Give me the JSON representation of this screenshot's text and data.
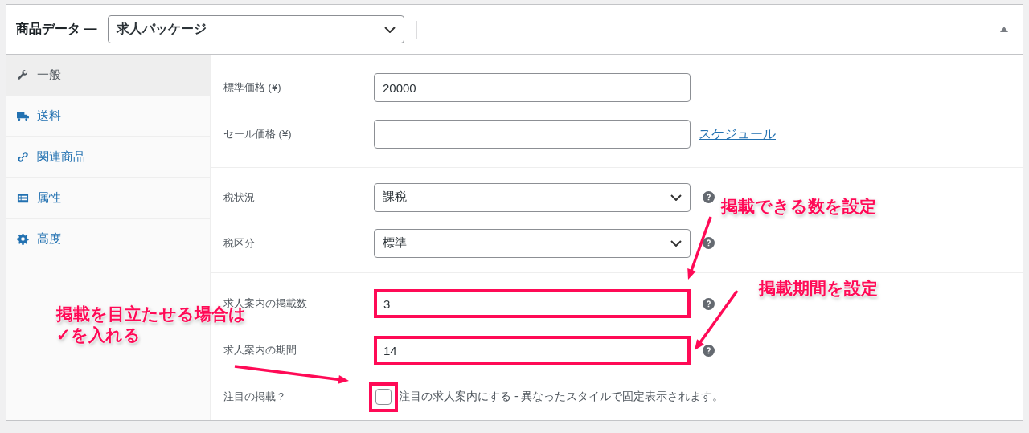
{
  "header": {
    "title": "商品データ —",
    "product_type": "求人パッケージ",
    "expanded": true
  },
  "tabs": [
    {
      "label": "一般",
      "selected": true
    },
    {
      "label": "送料",
      "selected": false
    },
    {
      "label": "関連商品",
      "selected": false
    },
    {
      "label": "属性",
      "selected": false
    },
    {
      "label": "高度",
      "selected": false
    }
  ],
  "sections": [
    {
      "fields": [
        {
          "kind": "input",
          "label": "標準価格 (¥)",
          "value": "20000",
          "highlighted": false
        },
        {
          "kind": "input",
          "label": "セール価格 (¥)",
          "link": "スケジュール",
          "highlighted": false
        }
      ]
    },
    {
      "fields": [
        {
          "kind": "select",
          "label": "税状況",
          "value": "課税",
          "help": true,
          "highlighted": false
        },
        {
          "kind": "select",
          "label": "税区分",
          "value": "標準",
          "help": true,
          "highlighted": false
        }
      ]
    },
    {
      "fields": [
        {
          "kind": "input",
          "label": "求人案内の掲載数",
          "value": "3",
          "help": true,
          "highlighted": true
        },
        {
          "kind": "input",
          "label": "求人案内の期間",
          "value": "14",
          "help": true,
          "highlighted": true
        },
        {
          "kind": "checkbox",
          "label": "注目の掲載？",
          "checked": false,
          "description": "注目の求人案内にする - 異なったスタイルで固定表示されます。",
          "highlighted": true
        }
      ]
    }
  ],
  "callouts": [
    {
      "lines": [
        "掲載できる数を設定"
      ]
    },
    {
      "lines": [
        "掲載期間を設定"
      ]
    },
    {
      "lines": [
        "掲載を目立たせる場合は",
        "✓を入れる"
      ]
    }
  ]
}
